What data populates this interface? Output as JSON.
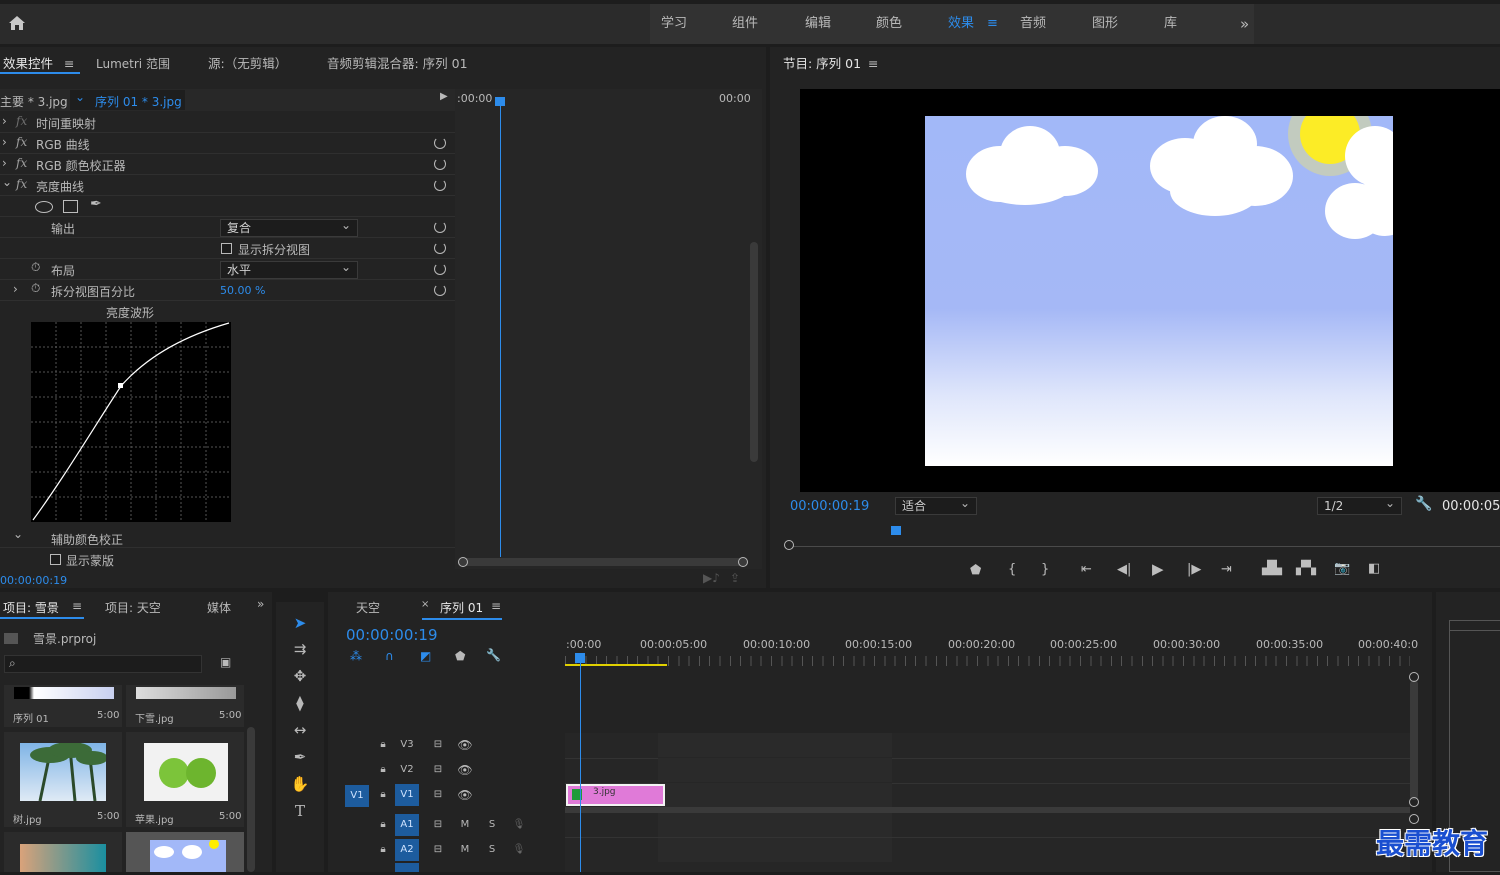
{
  "workspaces": [
    "学习",
    "组件",
    "编辑",
    "颜色",
    "效果",
    "音频",
    "图形",
    "库"
  ],
  "active_workspace": "效果",
  "workspace_menu_icon": "≡",
  "more_workspaces": "»",
  "effect_panel": {
    "tabs": [
      "效果控件",
      "Lumetri 范围",
      "源:（无剪辑）",
      "音频剪辑混合器: 序列 01"
    ],
    "master_label": "主要 * 3.jpg",
    "clip_label": "序列 01 * 3.jpg",
    "time_start": ":00:00",
    "time_end": "00:00",
    "effects": [
      "时间重映射",
      "RGB 曲线",
      "RGB 颜色校正器",
      "亮度曲线"
    ],
    "output_label": "输出",
    "output_value": "复合",
    "split_view_label": "显示拆分视图",
    "layout_label": "布局",
    "layout_value": "水平",
    "split_percent_label": "拆分视图百分比",
    "split_percent_value": "50.00 %",
    "waveform_label": "亮度波形",
    "secondary_label": "辅助颜色校正",
    "mask_label": "显示蒙版",
    "current_time": "00:00:00:19"
  },
  "program_monitor": {
    "title": "节目: 序列 01",
    "timecode": "00:00:00:19",
    "fit": "适合",
    "resolution": "1/2",
    "duration": "00:00:05"
  },
  "project_panel": {
    "tabs": [
      "项目: 雪景",
      "项目: 天空",
      "媒体"
    ],
    "project_file": "雪景.prproj",
    "items": [
      {
        "name": "序列 01",
        "duration": "5:00"
      },
      {
        "name": "下雪.jpg",
        "duration": "5:00"
      },
      {
        "name": "树.jpg",
        "duration": "5:00"
      },
      {
        "name": "苹果.jpg",
        "duration": "5:00"
      }
    ]
  },
  "timeline": {
    "tabs": [
      "天空",
      "序列 01"
    ],
    "timecode": "00:00:00:19",
    "ruler": [
      ":00:00",
      "00:00:05:00",
      "00:00:10:00",
      "00:00:15:00",
      "00:00:20:00",
      "00:00:25:00",
      "00:00:30:00",
      "00:00:35:00",
      "00:00:40:0"
    ],
    "video_tracks": [
      "V3",
      "V2",
      "V1"
    ],
    "audio_tracks": [
      "A1",
      "A2"
    ],
    "source_patch": "V1",
    "clip_name": "3.jpg",
    "mute": "M",
    "solo": "S"
  },
  "watermark": "最需教育"
}
